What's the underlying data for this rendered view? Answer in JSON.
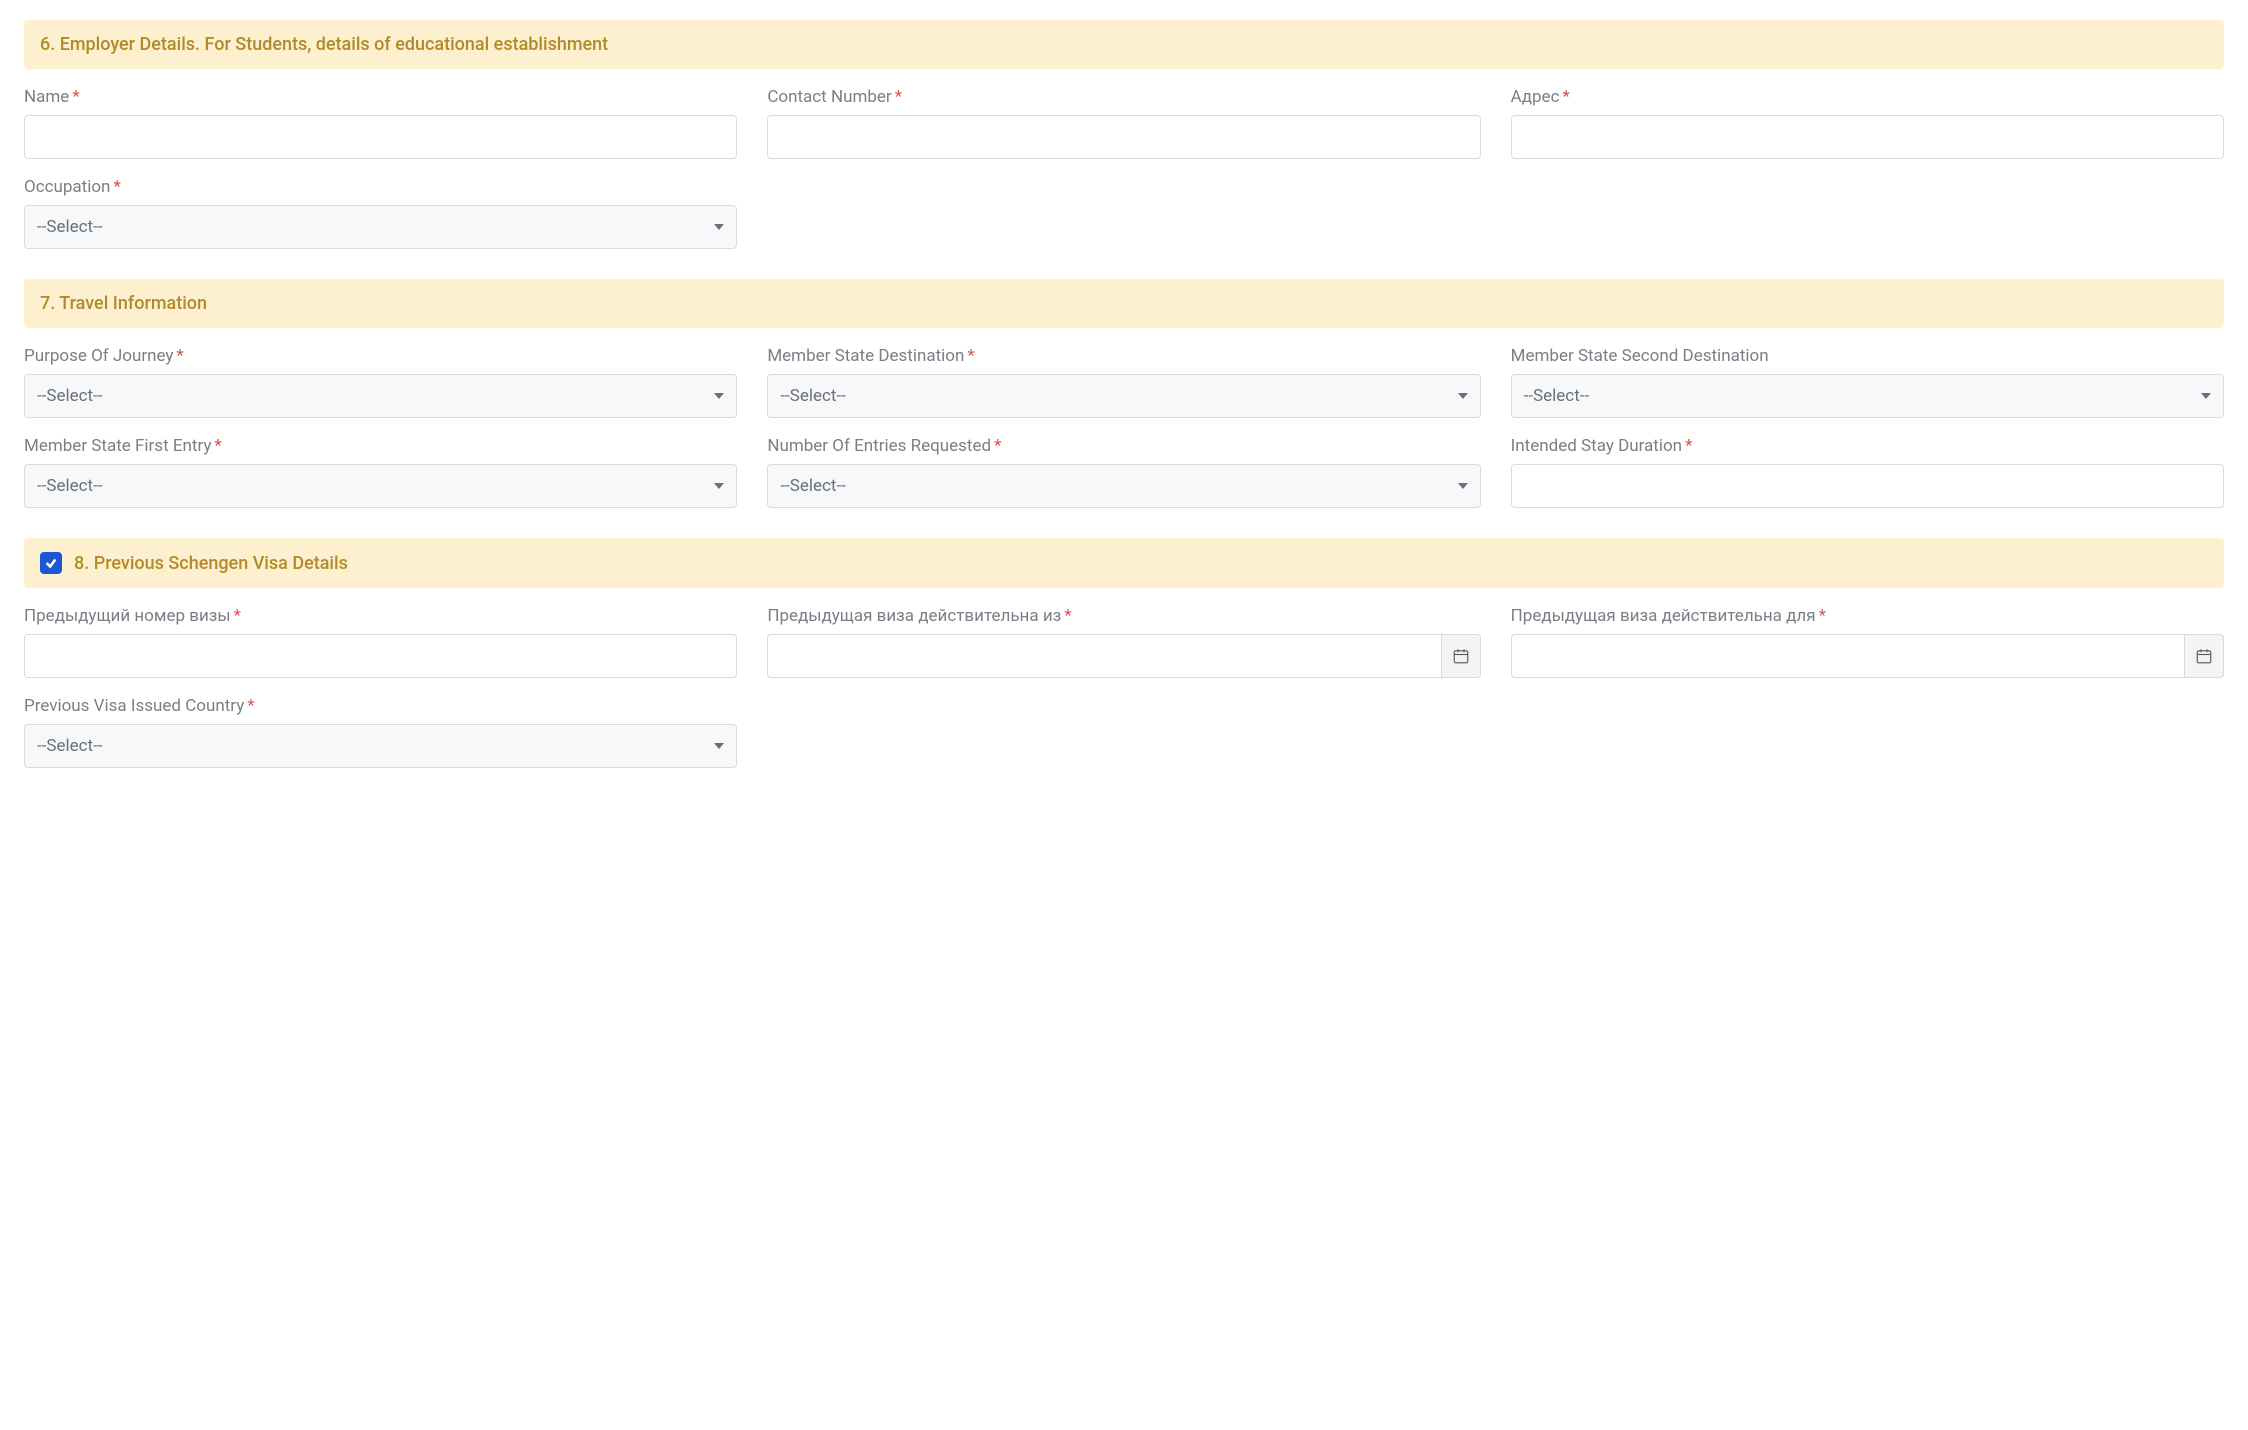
{
  "select_placeholder": "--Select--",
  "required_marker": "*",
  "sections": {
    "employer": {
      "title": "6. Employer Details. For Students, details of educational establishment",
      "fields": {
        "name": {
          "label": "Name",
          "required": true
        },
        "contact_number": {
          "label": "Contact Number",
          "required": true
        },
        "address": {
          "label": "Адрес",
          "required": true
        },
        "occupation": {
          "label": "Occupation",
          "required": true
        }
      }
    },
    "travel": {
      "title": "7. Travel Information",
      "fields": {
        "purpose": {
          "label": "Purpose Of Journey",
          "required": true
        },
        "dest": {
          "label": "Member State Destination",
          "required": true
        },
        "dest2": {
          "label": "Member State Second Destination",
          "required": false
        },
        "first_entry": {
          "label": "Member State First Entry",
          "required": true
        },
        "entries": {
          "label": "Number Of Entries Requested",
          "required": true
        },
        "duration": {
          "label": "Intended Stay Duration",
          "required": true
        }
      }
    },
    "previous": {
      "title": "8. Previous Schengen Visa Details",
      "checked": true,
      "fields": {
        "prev_number": {
          "label": "Предыдущий номер визы",
          "required": true
        },
        "valid_from": {
          "label": "Предыдущая виза действительна из",
          "required": true
        },
        "valid_to": {
          "label": "Предыдущая виза действительна для",
          "required": true
        },
        "issued_country": {
          "label": "Previous Visa Issued Country",
          "required": true
        }
      }
    }
  }
}
